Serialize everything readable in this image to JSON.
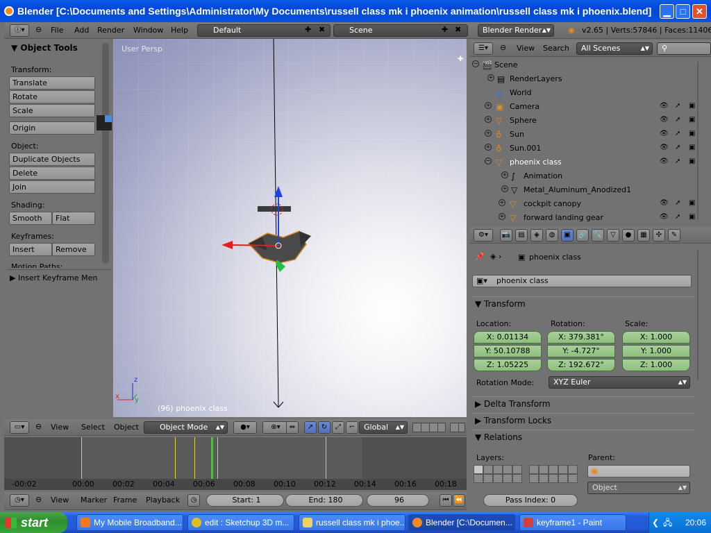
{
  "window": {
    "title": "Blender [C:\\Documents and Settings\\Administrator\\My Documents\\russell class mk i phoenix animation\\russell class mk i phoenix.blend]",
    "min_glyph": "▁",
    "max_glyph": "□",
    "close_glyph": "✕"
  },
  "topbar": {
    "menus": [
      "File",
      "Add",
      "Render",
      "Window",
      "Help"
    ],
    "layout": "Default",
    "scene": "Scene",
    "engine": "Blender Render",
    "stats": "v2.65 | Verts:57846 | Faces:114060"
  },
  "toolshelf": {
    "title": "Object Tools",
    "transform_label": "Transform:",
    "translate": "Translate",
    "rotate": "Rotate",
    "scale": "Scale",
    "origin": "Origin",
    "object_label": "Object:",
    "duplicate": "Duplicate Objects",
    "delete": "Delete",
    "join": "Join",
    "shading_label": "Shading:",
    "smooth": "Smooth",
    "flat": "Flat",
    "keyframes_label": "Keyframes:",
    "insert": "Insert",
    "remove": "Remove",
    "motion_paths_label": "Motion Paths:",
    "insert_keyframe_menu": "Insert Keyframe Men"
  },
  "viewport": {
    "view_name": "User Persp",
    "object_label": "(96) phoenix class",
    "axis_x": "x",
    "axis_y": "y",
    "axis_z": "z"
  },
  "viewport_header": {
    "menus": [
      "View",
      "Select",
      "Object"
    ],
    "mode": "Object Mode",
    "orientation": "Global"
  },
  "timeline": {
    "ticks": [
      "-00:02",
      "00:00",
      "00:02",
      "00:04",
      "00:06",
      "00:08",
      "00:10",
      "00:12",
      "00:14",
      "00:16",
      "00:18"
    ],
    "menus": [
      "View",
      "Marker",
      "Frame",
      "Playback"
    ],
    "start": "Start: 1",
    "end": "End: 180",
    "current": "96"
  },
  "outliner_header": {
    "view": "View",
    "search": "Search",
    "scenes": "All Scenes"
  },
  "outliner": {
    "items": [
      {
        "name": "Scene",
        "icon": "scene-icon"
      },
      {
        "name": "RenderLayers",
        "icon": "render-layers-icon"
      },
      {
        "name": "World",
        "icon": "world-icon"
      },
      {
        "name": "Camera",
        "icon": "camera-icon"
      },
      {
        "name": "Sphere",
        "icon": "mesh-icon"
      },
      {
        "name": "Sun",
        "icon": "lamp-icon"
      },
      {
        "name": "Sun.001",
        "icon": "lamp-icon"
      },
      {
        "name": "phoenix class",
        "icon": "mesh-icon"
      },
      {
        "name": "Animation",
        "icon": "animation-icon"
      },
      {
        "name": "Metal_Aluminum_Anodized1",
        "icon": "mesh-data-icon"
      },
      {
        "name": "cockpit canopy",
        "icon": "mesh-icon"
      },
      {
        "name": "forward landing gear",
        "icon": "mesh-icon"
      }
    ]
  },
  "properties": {
    "breadcrumb": "phoenix class",
    "object_name": "phoenix class",
    "transform_title": "Transform",
    "location_label": "Location:",
    "rotation_label": "Rotation:",
    "scale_label": "Scale:",
    "location": [
      "X: 0.01134",
      "Y: 50.10788",
      "Z: 1.05225"
    ],
    "rotation": [
      "X: 379.381°",
      "Y: -4.727°",
      "Z: 192.672°"
    ],
    "scale": [
      "X: 1.000",
      "Y: 1.000",
      "Z: 1.000"
    ],
    "rotation_mode_label": "Rotation Mode:",
    "rotation_mode": "XYZ Euler",
    "delta_title": "Delta Transform",
    "locks_title": "Transform Locks",
    "relations_title": "Relations",
    "layers_label": "Layers:",
    "parent_label": "Parent:",
    "parent_type": "Object",
    "pass_index": "Pass Index: 0"
  },
  "taskbar": {
    "start": "start",
    "tasks": [
      "My Mobile Broadband...",
      "edit : Sketchup 3D m...",
      "russell class mk i phoe...",
      "Blender [C:\\Documen...",
      "keyframe1 - Paint"
    ],
    "clock": "20:06"
  }
}
